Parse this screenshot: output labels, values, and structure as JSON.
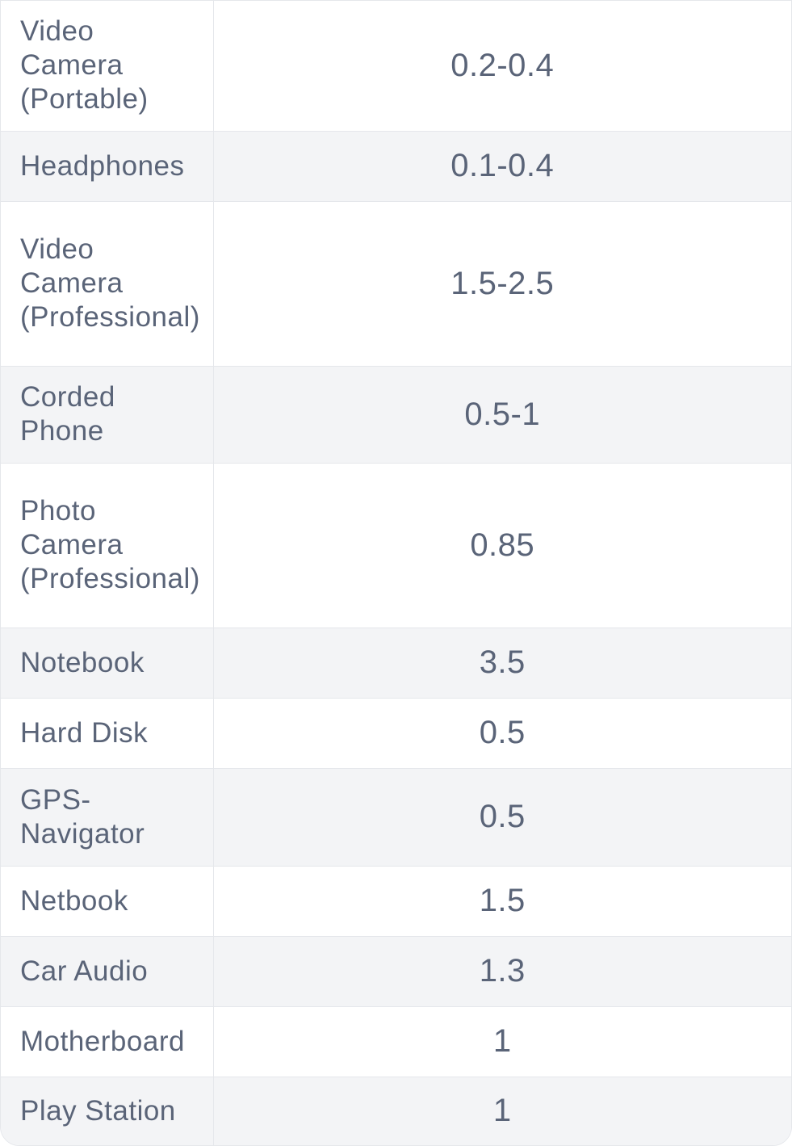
{
  "rows": [
    {
      "name": "Video Camera (Portable)",
      "value": "0.2-0.4"
    },
    {
      "name": "Headphones",
      "value": "0.1-0.4"
    },
    {
      "name": "Video Camera (Professional)",
      "value": "1.5-2.5"
    },
    {
      "name": "Corded Phone",
      "value": "0.5-1"
    },
    {
      "name": "Photo Camera (Professional)",
      "value": "0.85"
    },
    {
      "name": "Notebook",
      "value": "3.5"
    },
    {
      "name": "Hard Disk",
      "value": "0.5"
    },
    {
      "name": "GPS-Navigator",
      "value": "0.5"
    },
    {
      "name": "Netbook",
      "value": "1.5"
    },
    {
      "name": "Car Audio",
      "value": "1.3"
    },
    {
      "name": "Motherboard",
      "value": "1"
    },
    {
      "name": "Play Station",
      "value": "1"
    }
  ]
}
